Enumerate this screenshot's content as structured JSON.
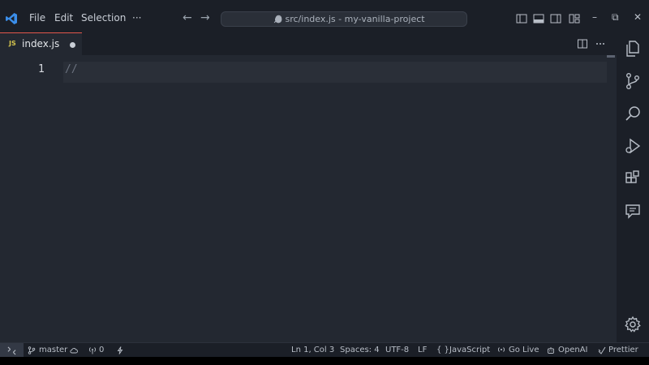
{
  "window": {
    "menu": [
      "File",
      "Edit",
      "Selection",
      "···"
    ],
    "command_center": "● src/index.js - my-vanilla-project",
    "controls": {
      "minimize": "–",
      "restore": "⧉",
      "close": "✕"
    }
  },
  "tab": {
    "badge": "JS",
    "filename": "index.js",
    "modified": true
  },
  "editor": {
    "line_number": "1",
    "code": "//"
  },
  "activity_icons": [
    "explorer-icon",
    "source-control-icon",
    "search-icon",
    "run-debug-icon",
    "extensions-icon",
    "chat-icon",
    "settings-gear-icon"
  ],
  "status": {
    "branch": "master",
    "problems": "0",
    "position": "Ln 1, Col 3",
    "spaces": "Spaces: 4",
    "encoding": "UTF-8",
    "eol": "LF",
    "language_icon": "{ }",
    "language": "JavaScript",
    "golive": "Go Live",
    "openai": "OpenAI",
    "prettier": "Prettier"
  },
  "colors": {
    "accent_tab_border": "#e2574c",
    "js_badge": "#d6c64e",
    "logo": "#3b8eea"
  }
}
